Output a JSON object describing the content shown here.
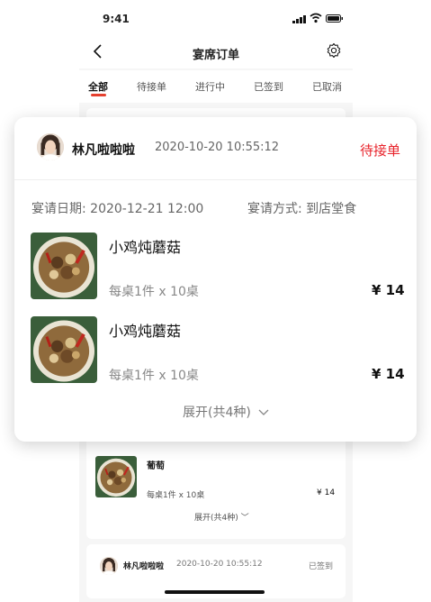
{
  "status_bar": {
    "time": "9:41"
  },
  "nav": {
    "title": "宴席订单"
  },
  "tabs": [
    {
      "label": "全部",
      "active": true
    },
    {
      "label": "待接单",
      "active": false
    },
    {
      "label": "进行中",
      "active": false
    },
    {
      "label": "已签到",
      "active": false
    },
    {
      "label": "已取消",
      "active": false
    }
  ],
  "popup": {
    "user": "林凡啦啦啦",
    "datetime": "2020-10-20 10:55:12",
    "status": "待接单",
    "date_label": "宴请日期: 2020-12-21  12:00",
    "method_label": "宴请方式: 到店堂食",
    "items": [
      {
        "name": "小鸡炖蘑菇",
        "qty": "每桌1件 x 10桌",
        "price": "¥ 14"
      },
      {
        "name": "小鸡炖蘑菇",
        "qty": "每桌1件 x 10桌",
        "price": "¥ 14"
      }
    ],
    "expand": "展开(共4种)"
  },
  "bg_card": {
    "item": {
      "name": "葡萄",
      "qty": "每桌1件 x 10桌",
      "price": "¥ 14"
    },
    "expand": "展开(共4种)"
  },
  "bg_card2": {
    "user": "林凡啦啦啦",
    "datetime": "2020-10-20 10:55:12",
    "status": "已签到"
  },
  "colors": {
    "accent": "#e8242c",
    "tab_indicator": "#e5402f"
  }
}
